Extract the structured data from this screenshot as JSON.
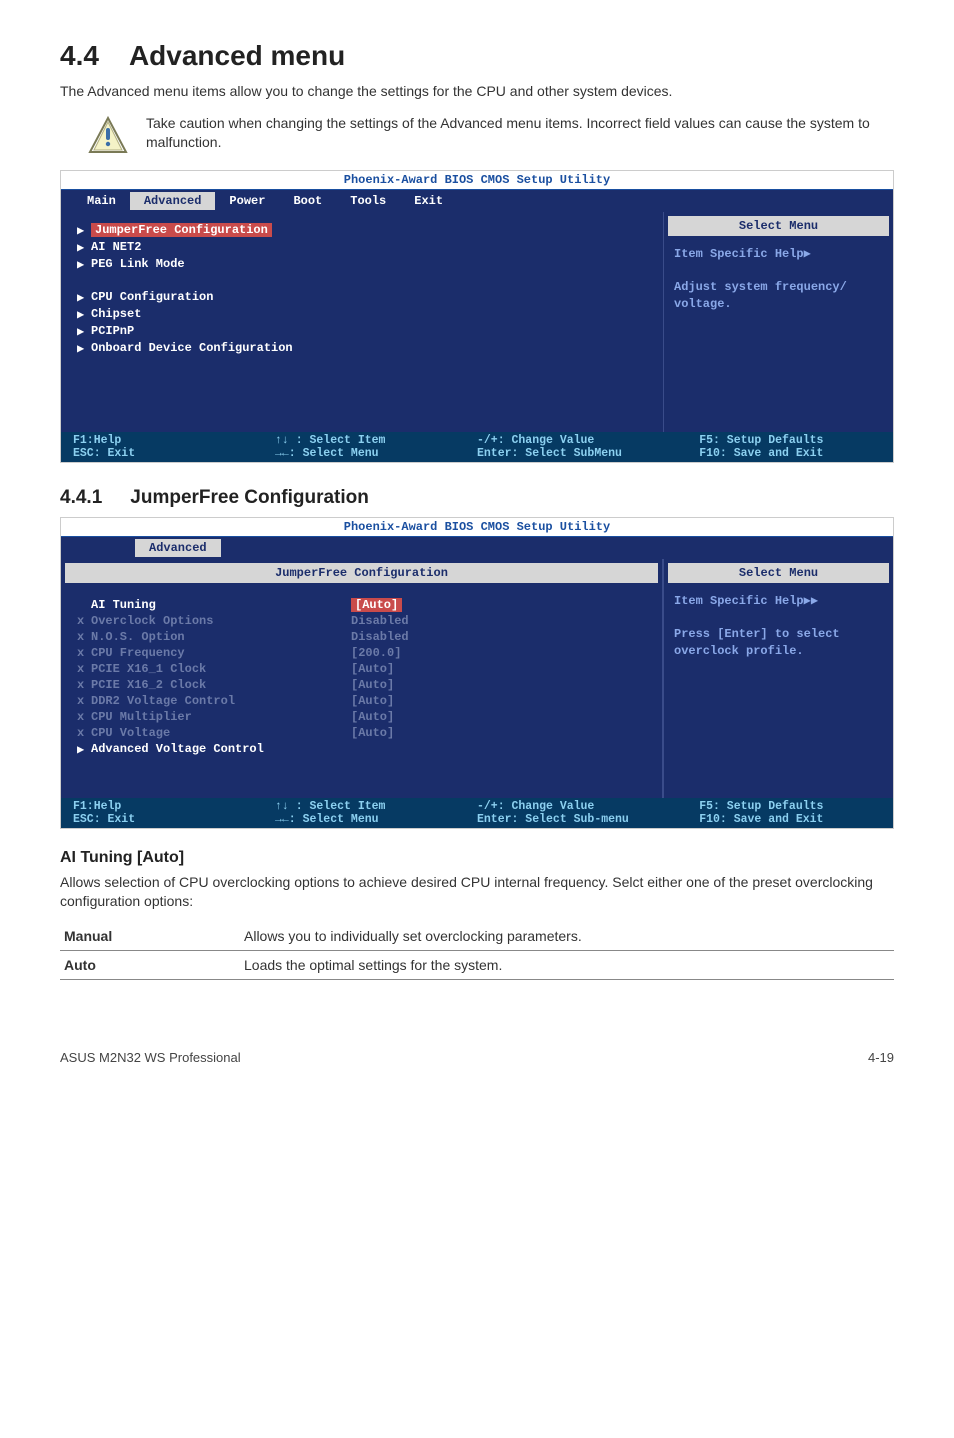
{
  "section": {
    "number": "4.4",
    "title": "Advanced menu",
    "intro": "The Advanced menu items allow you to change the settings for the CPU and other system devices.",
    "callout": "Take caution when changing the settings of the Advanced menu items. Incorrect field values can cause the system to malfunction."
  },
  "bios1": {
    "title": "Phoenix-Award BIOS CMOS Setup Utility",
    "tabs": [
      "Main",
      "Advanced",
      "Power",
      "Boot",
      "Tools",
      "Exit"
    ],
    "active_tab": "Advanced",
    "left_items": [
      {
        "marker": "▶",
        "label": "JumperFree Configuration",
        "highlighted": true
      },
      {
        "marker": "▶",
        "label": "AI NET2"
      },
      {
        "marker": "▶",
        "label": "PEG Link Mode"
      },
      {
        "spacer": true
      },
      {
        "marker": "▶",
        "label": "CPU Configuration"
      },
      {
        "marker": "▶",
        "label": "Chipset"
      },
      {
        "marker": "▶",
        "label": "PCIPnP"
      },
      {
        "marker": "▶",
        "label": "Onboard Device Configuration"
      }
    ],
    "right_header": "Select Menu",
    "right_lines": [
      "Item Specific Help▶",
      "",
      "Adjust system frequency/",
      "voltage."
    ],
    "footer": {
      "c1a": "F1:Help",
      "c1b": "ESC: Exit",
      "c2a": "↑↓ : Select Item",
      "c2b": "→←: Select Menu",
      "c3a": "-/+: Change Value",
      "c3b": "Enter: Select SubMenu",
      "c4a": "F5: Setup Defaults",
      "c4b": "F10: Save and Exit"
    }
  },
  "subsection": {
    "number": "4.4.1",
    "title": "JumperFree Configuration"
  },
  "bios2": {
    "title": "Phoenix-Award BIOS CMOS Setup Utility",
    "active_tab": "Advanced",
    "panel_header": "JumperFree Configuration",
    "right_header": "Select Menu",
    "rows": [
      {
        "marker": " ",
        "label": "AI Tuning",
        "value": "[Auto]",
        "dim": false,
        "val_hl": true
      },
      {
        "marker": "x",
        "label": "Overclock Options",
        "value": "Disabled",
        "dim": true
      },
      {
        "marker": "x",
        "label": "N.O.S. Option",
        "value": "Disabled",
        "dim": true
      },
      {
        "marker": "x",
        "label": "CPU Frequency",
        "value": "[200.0]",
        "dim": true
      },
      {
        "marker": "x",
        "label": "PCIE X16_1 Clock",
        "value": "[Auto]",
        "dim": true
      },
      {
        "marker": "x",
        "label": "PCIE X16_2 Clock",
        "value": "[Auto]",
        "dim": true
      },
      {
        "marker": "x",
        "label": "DDR2 Voltage Control",
        "value": "[Auto]",
        "dim": true
      },
      {
        "marker": "x",
        "label": "CPU Multiplier",
        "value": "[Auto]",
        "dim": true
      },
      {
        "marker": "x",
        "label": "CPU Voltage",
        "value": "[Auto]",
        "dim": true
      },
      {
        "marker": "▶",
        "label": "Advanced Voltage Control",
        "value": "",
        "dim": false
      }
    ],
    "right_lines": [
      "Item Specific Help▶▶",
      "",
      "Press [Enter] to select",
      "overclock profile."
    ],
    "footer": {
      "c1a": "F1:Help",
      "c1b": "ESC: Exit",
      "c2a": "↑↓ : Select Item",
      "c2b": "→←: Select Menu",
      "c3a": "-/+: Change Value",
      "c3b": "Enter: Select Sub-menu",
      "c4a": "F5: Setup Defaults",
      "c4b": "F10: Save and Exit"
    }
  },
  "ai_tuning": {
    "heading": "AI Tuning [Auto]",
    "desc": "Allows selection of CPU overclocking options to achieve desired CPU internal frequency. Selct either one of the preset overclocking configuration options:",
    "options": [
      {
        "key": "Manual",
        "desc": "Allows you to individually set overclocking parameters."
      },
      {
        "key": "Auto",
        "desc": "Loads the optimal settings for the system."
      }
    ]
  },
  "footer": {
    "left": "ASUS M2N32 WS Professional",
    "right": "4-19"
  }
}
